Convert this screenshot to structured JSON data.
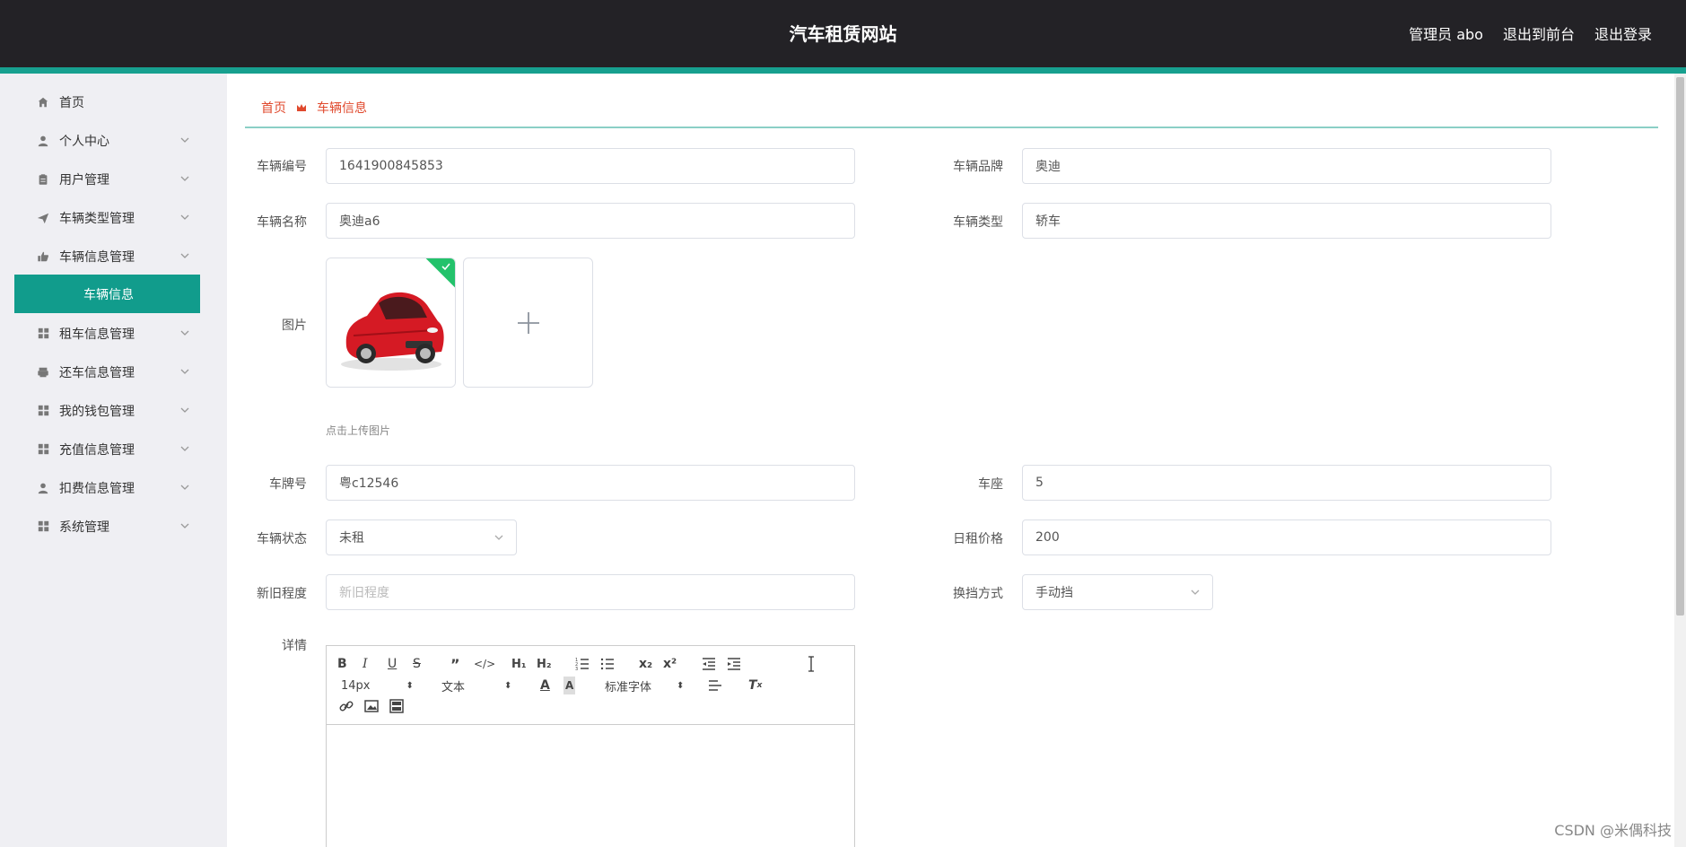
{
  "header": {
    "title": "汽车租赁网站",
    "user": "管理员 abo",
    "to_front": "退出到前台",
    "logout": "退出登录"
  },
  "sidebar": {
    "items": [
      {
        "label": "首页",
        "icon": "home-icon"
      },
      {
        "label": "个人中心",
        "icon": "user-icon"
      },
      {
        "label": "用户管理",
        "icon": "clipboard-icon"
      },
      {
        "label": "车辆类型管理",
        "icon": "send-icon"
      },
      {
        "label": "车辆信息管理",
        "icon": "thumb-icon"
      },
      {
        "label": "车辆信息",
        "icon": ""
      },
      {
        "label": "租车信息管理",
        "icon": "grid-icon"
      },
      {
        "label": "还车信息管理",
        "icon": "printer-icon"
      },
      {
        "label": "我的钱包管理",
        "icon": "grid-icon"
      },
      {
        "label": "充值信息管理",
        "icon": "grid-icon"
      },
      {
        "label": "扣费信息管理",
        "icon": "user-icon"
      },
      {
        "label": "系统管理",
        "icon": "grid-icon"
      }
    ]
  },
  "breadcrumb": {
    "home": "首页",
    "current": "车辆信息"
  },
  "form": {
    "vehicle_no": {
      "label": "车辆编号",
      "value": "1641900845853"
    },
    "brand": {
      "label": "车辆品牌",
      "value": "奥迪"
    },
    "name": {
      "label": "车辆名称",
      "value": "奥迪a6"
    },
    "type": {
      "label": "车辆类型",
      "value": "轿车"
    },
    "picture": {
      "label": "图片",
      "hint": "点击上传图片"
    },
    "plate": {
      "label": "车牌号",
      "value": "粤c12546"
    },
    "seats": {
      "label": "车座",
      "value": "5"
    },
    "status": {
      "label": "车辆状态",
      "value": "未租"
    },
    "daily_price": {
      "label": "日租价格",
      "value": "200"
    },
    "condition": {
      "label": "新旧程度",
      "placeholder": "新旧程度"
    },
    "gear": {
      "label": "换挡方式",
      "value": "手动挡"
    },
    "details": {
      "label": "详情"
    }
  },
  "editor": {
    "font_size": "14px",
    "text_style": "文本",
    "font_family": "标准字体"
  },
  "watermark": "CSDN @米偶科技",
  "colors": {
    "topbar": "#232226",
    "accent": "#17a08f",
    "breadcrumb": "#e0492d"
  }
}
